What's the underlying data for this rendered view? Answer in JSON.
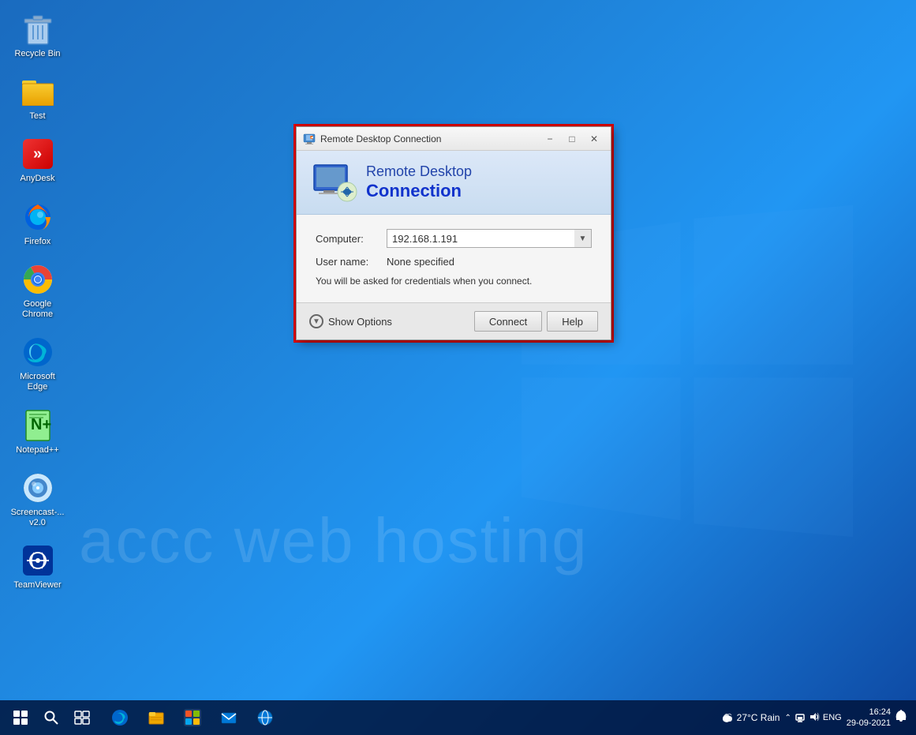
{
  "desktop": {
    "icons": [
      {
        "id": "recycle-bin",
        "label": "Recycle Bin",
        "type": "recycle"
      },
      {
        "id": "test",
        "label": "Test",
        "type": "folder"
      },
      {
        "id": "anydesk",
        "label": "AnyDesk",
        "type": "anydesk"
      },
      {
        "id": "firefox",
        "label": "Firefox",
        "type": "firefox"
      },
      {
        "id": "google-chrome",
        "label": "Google Chrome",
        "type": "chrome"
      },
      {
        "id": "microsoft-edge",
        "label": "Microsoft Edge",
        "type": "edge"
      },
      {
        "id": "notepadpp",
        "label": "Notepad++",
        "type": "notepadpp"
      },
      {
        "id": "screencast",
        "label": "Screencast-...\nv2.0",
        "type": "screencast"
      },
      {
        "id": "teamviewer",
        "label": "TeamViewer",
        "type": "teamviewer"
      }
    ],
    "watermark_text": "accc web hosting"
  },
  "rdp_dialog": {
    "title_bar": {
      "title": "Remote Desktop Connection",
      "icon": "remote-desktop-icon"
    },
    "header": {
      "line1": "Remote Desktop",
      "line2": "Connection"
    },
    "fields": {
      "computer_label": "Computer:",
      "computer_value": "192.168.1.191",
      "username_label": "User name:",
      "username_value": "None specified",
      "info_text": "You will be asked for credentials when you connect."
    },
    "footer": {
      "show_options_label": "Show Options",
      "connect_label": "Connect",
      "help_label": "Help"
    }
  },
  "taskbar": {
    "system_tray": {
      "weather": "27°C Rain",
      "time": "16:24",
      "date": "29-09-2021",
      "language": "ENG"
    }
  }
}
